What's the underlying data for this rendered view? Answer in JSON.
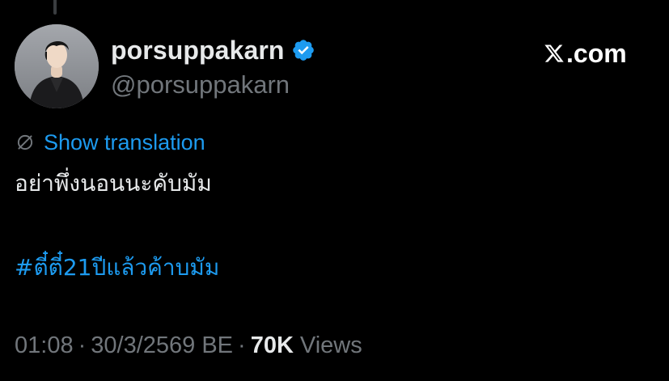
{
  "author": {
    "display_name": "porsuppakarn",
    "handle": "@porsuppakarn",
    "verified": true,
    "avatar_icon": "profile-photo"
  },
  "brand": {
    "label": ".com",
    "logo_icon": "x-logo-icon"
  },
  "translation": {
    "label": "Show translation",
    "icon": "translate-icon"
  },
  "tweet": {
    "text": "อย่าพึ่งนอนนะคับมัม",
    "hashtag": "#ตี๋ตี๋21ปีแล้วค้าบมัม"
  },
  "meta": {
    "time": "01:08",
    "date": "30/3/2569 BE",
    "separator": "·",
    "views_count": "70K",
    "views_label": "Views"
  },
  "colors": {
    "background": "#000000",
    "primary_text": "#e7e9ea",
    "secondary_text": "#71767b",
    "link": "#1d9bf0",
    "verified": "#1d9bf0"
  }
}
